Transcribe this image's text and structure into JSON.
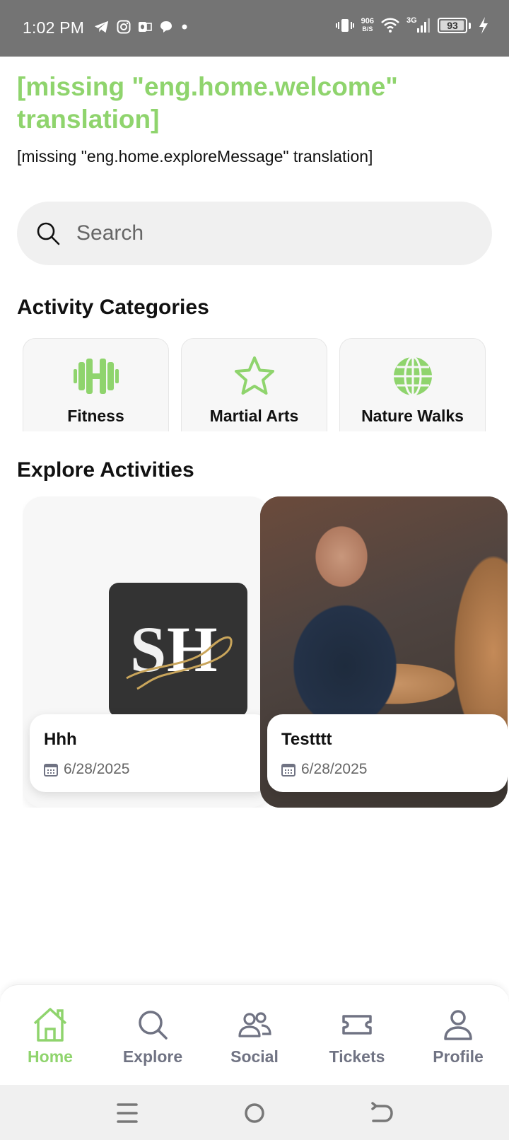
{
  "status_bar": {
    "time": "1:02 PM",
    "net_speed_value": "906",
    "net_speed_unit": "B/S",
    "network_type": "3G",
    "battery_level": "93",
    "icons": [
      "telegram-icon",
      "instagram-icon",
      "outlook-icon",
      "chat-icon",
      "dot-icon",
      "vibrate-icon",
      "wifi-icon",
      "signal-icon",
      "battery-icon",
      "charging-icon"
    ]
  },
  "home": {
    "welcome": "[missing \"eng.home.welcome\" translation]",
    "explore_message": "[missing \"eng.home.exploreMessage\" translation]"
  },
  "search": {
    "placeholder": "Search"
  },
  "categories": {
    "title": "Activity Categories",
    "items": [
      {
        "label": "Fitness",
        "icon": "dumbbell-icon"
      },
      {
        "label": "Martial Arts",
        "icon": "star-icon"
      },
      {
        "label": "Nature Walks",
        "icon": "globe-icon"
      }
    ]
  },
  "activities": {
    "title": "Explore Activities",
    "items": [
      {
        "title": "Hhh",
        "date": "6/28/2025",
        "image": "sh-logo"
      },
      {
        "title": "Testttt",
        "date": "6/28/2025",
        "image": "people-photo"
      }
    ]
  },
  "bottom_nav": {
    "items": [
      {
        "label": "Home",
        "icon": "home-icon",
        "active": true
      },
      {
        "label": "Explore",
        "icon": "search-icon",
        "active": false
      },
      {
        "label": "Social",
        "icon": "people-icon",
        "active": false
      },
      {
        "label": "Tickets",
        "icon": "ticket-icon",
        "active": false
      },
      {
        "label": "Profile",
        "icon": "person-icon",
        "active": false
      }
    ]
  },
  "colors": {
    "accent": "#8fd46d",
    "nav_inactive": "#707383",
    "status_bar": "#747474"
  }
}
